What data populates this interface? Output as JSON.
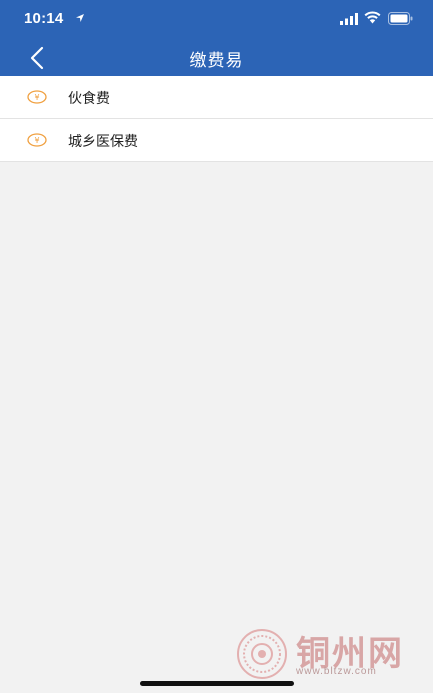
{
  "status_bar": {
    "time": "10:14",
    "icons": [
      "location-icon",
      "signal-icon",
      "wifi-icon",
      "battery-icon"
    ]
  },
  "header": {
    "title": "缴费易",
    "back_icon": "chevron-left-icon",
    "background": "#2c64b6"
  },
  "list": {
    "items": [
      {
        "label": "伙食费",
        "icon": "yen-coin-icon"
      },
      {
        "label": "城乡医保费",
        "icon": "yen-coin-icon"
      }
    ],
    "icon_symbol": "¥",
    "icon_color": "#f0a040"
  },
  "watermark": {
    "text": "铜州网",
    "url": "www.bltzw.com"
  }
}
